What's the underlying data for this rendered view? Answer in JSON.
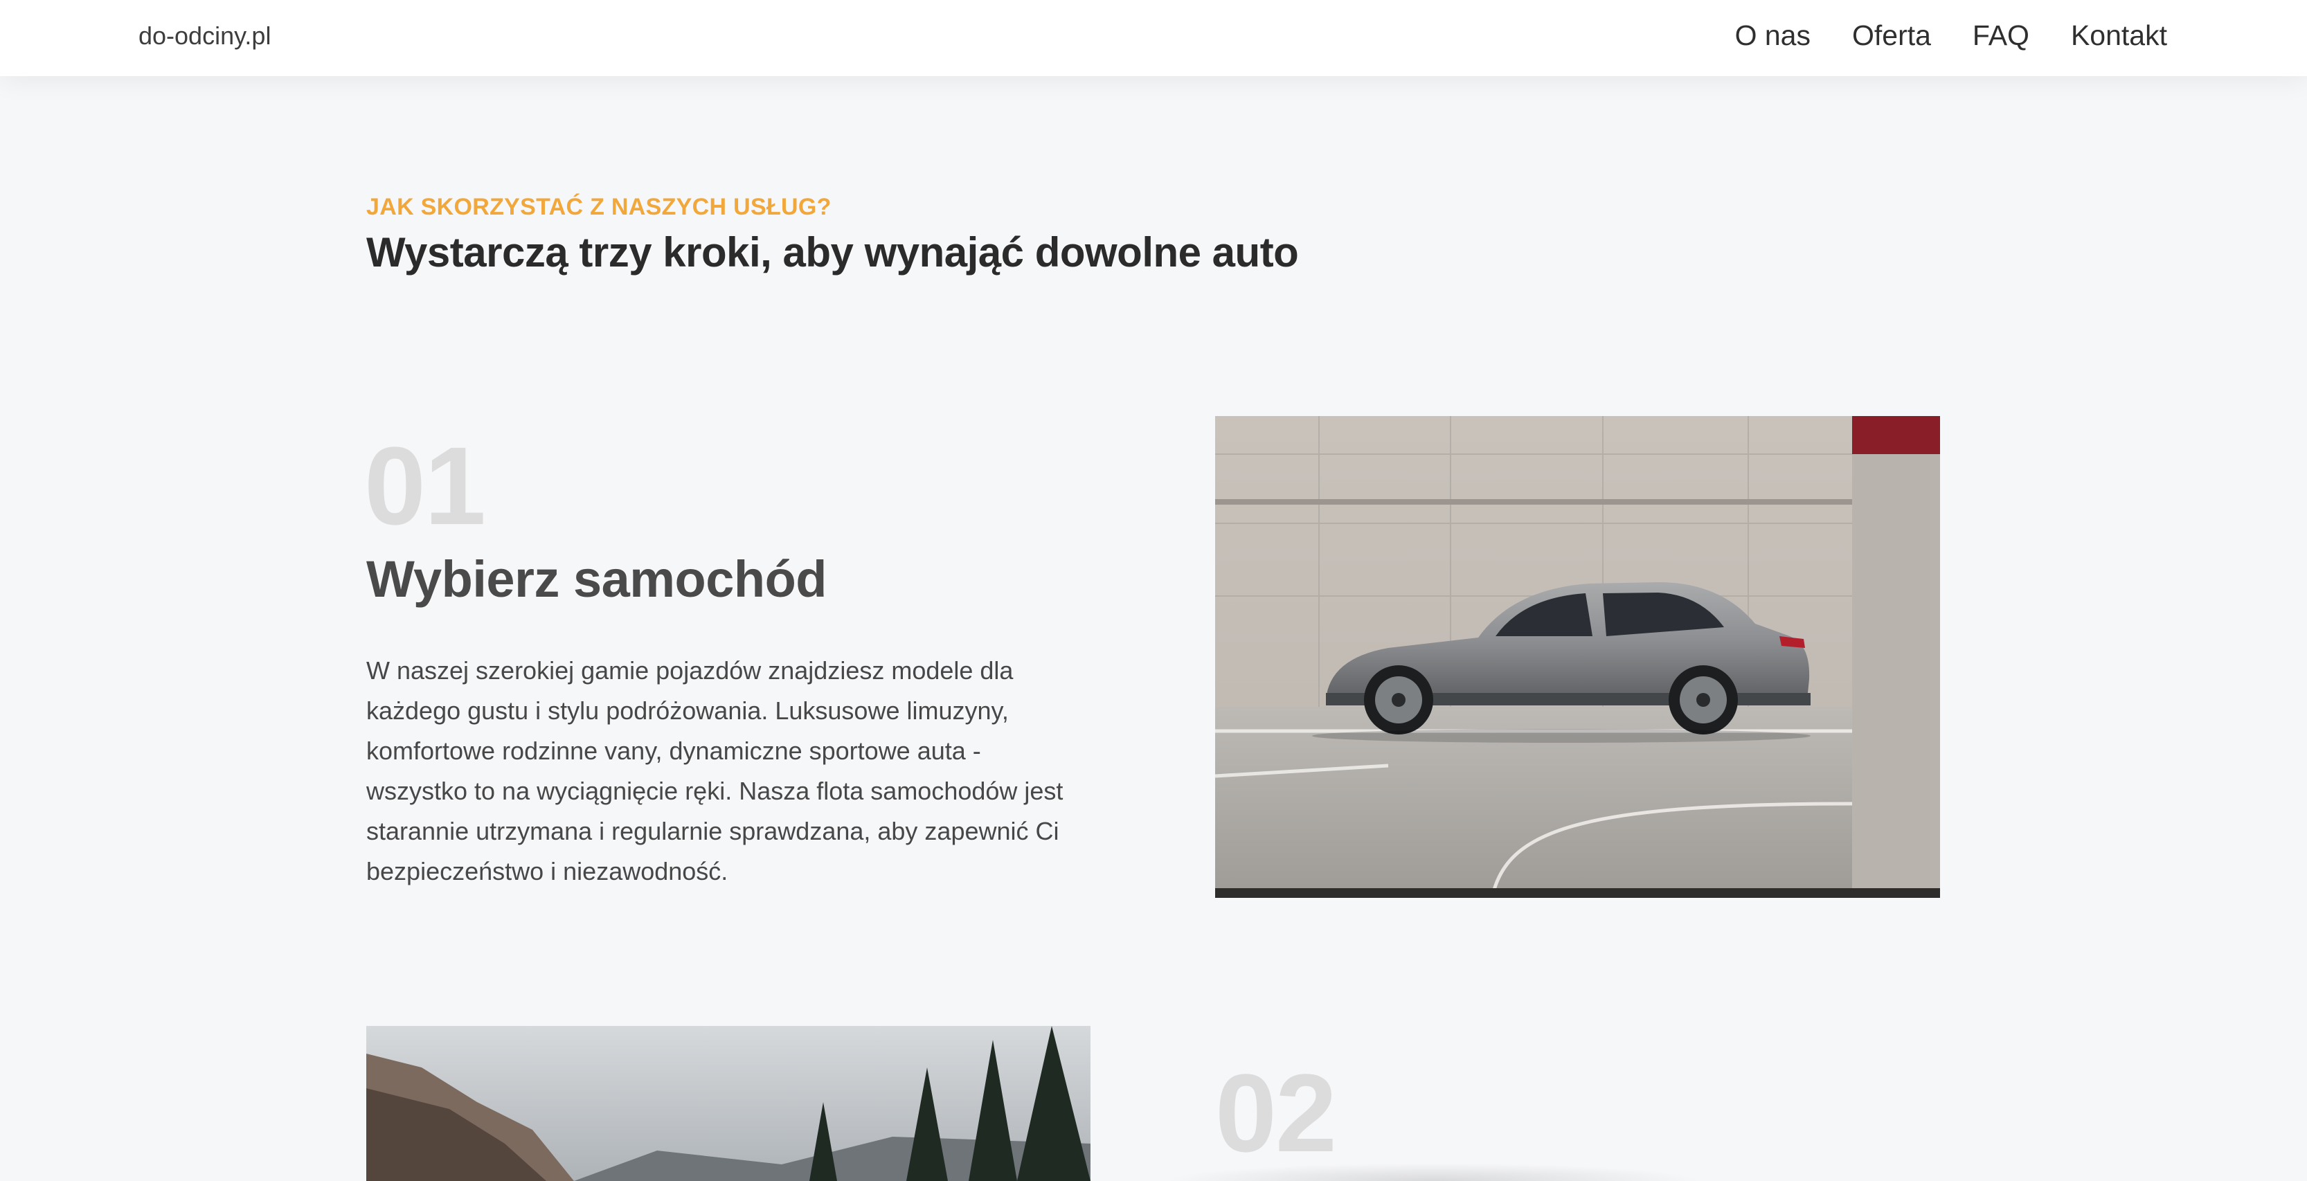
{
  "nav": {
    "brand": "do-odciny.pl",
    "links": [
      {
        "label": "O nas"
      },
      {
        "label": "Oferta"
      },
      {
        "label": "FAQ"
      },
      {
        "label": "Kontakt"
      }
    ]
  },
  "intro": {
    "eyebrow": "JAK SKORZYSTAĆ Z NASZYCH USŁUG?",
    "title": "Wystarczą trzy kroki, aby wynająć dowolne auto"
  },
  "steps": [
    {
      "number": "01",
      "title": "Wybierz samochód",
      "description": "W naszej szerokiej gamie pojazdów znajdziesz modele dla każdego gustu i stylu podróżowania. Luksusowe limuzyny, komfortowe rodzinne vany, dynamiczne sportowe auta - wszystko to na wyciągnięcie ręki. Nasza flota samochodów jest starannie utrzymana i regularnie sprawdzana, aby zapewnić Ci bezpieczeństwo i niezawodność."
    },
    {
      "number": "02"
    }
  ],
  "colors": {
    "accent": "#f2a73b",
    "background": "#f6f7f9",
    "number": "#dcdcdc"
  }
}
